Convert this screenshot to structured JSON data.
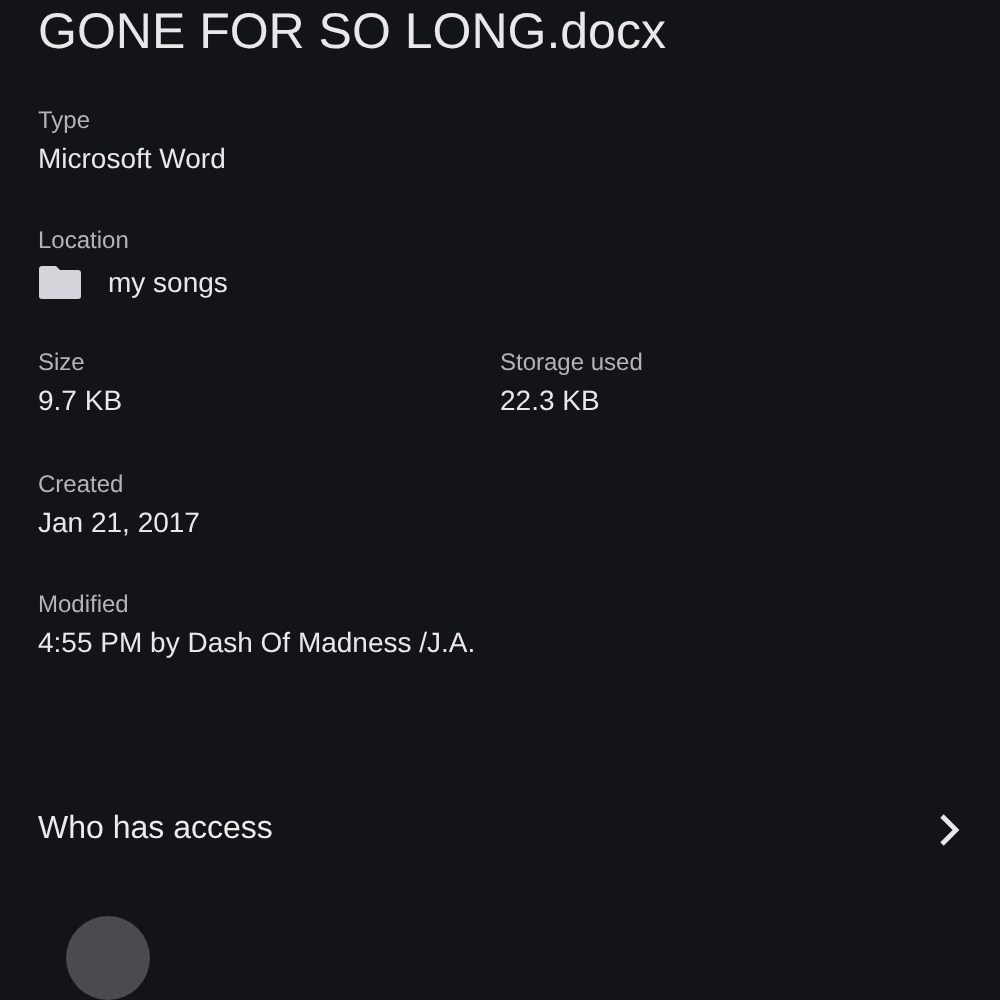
{
  "title": "GONE FOR SO LONG.docx",
  "sections": [
    {
      "fields": [
        {
          "label": "Type",
          "value": "Microsoft Word",
          "kind": "text"
        }
      ]
    },
    {
      "fields": [
        {
          "label": "Location",
          "value": "my songs",
          "kind": "folder"
        }
      ]
    },
    {
      "fields": [
        {
          "label": "Size",
          "value": "9.7 KB",
          "kind": "text"
        },
        {
          "label": "Storage used",
          "value": "22.3 KB",
          "kind": "text"
        }
      ]
    },
    {
      "fields": [
        {
          "label": "Created",
          "value": "Jan 21, 2017",
          "kind": "text"
        }
      ]
    },
    {
      "fields": [
        {
          "label": "Modified",
          "value": "4:55 PM by Dash Of Madness /J.A.",
          "kind": "text"
        }
      ]
    }
  ],
  "access": {
    "label": "Who has access"
  }
}
